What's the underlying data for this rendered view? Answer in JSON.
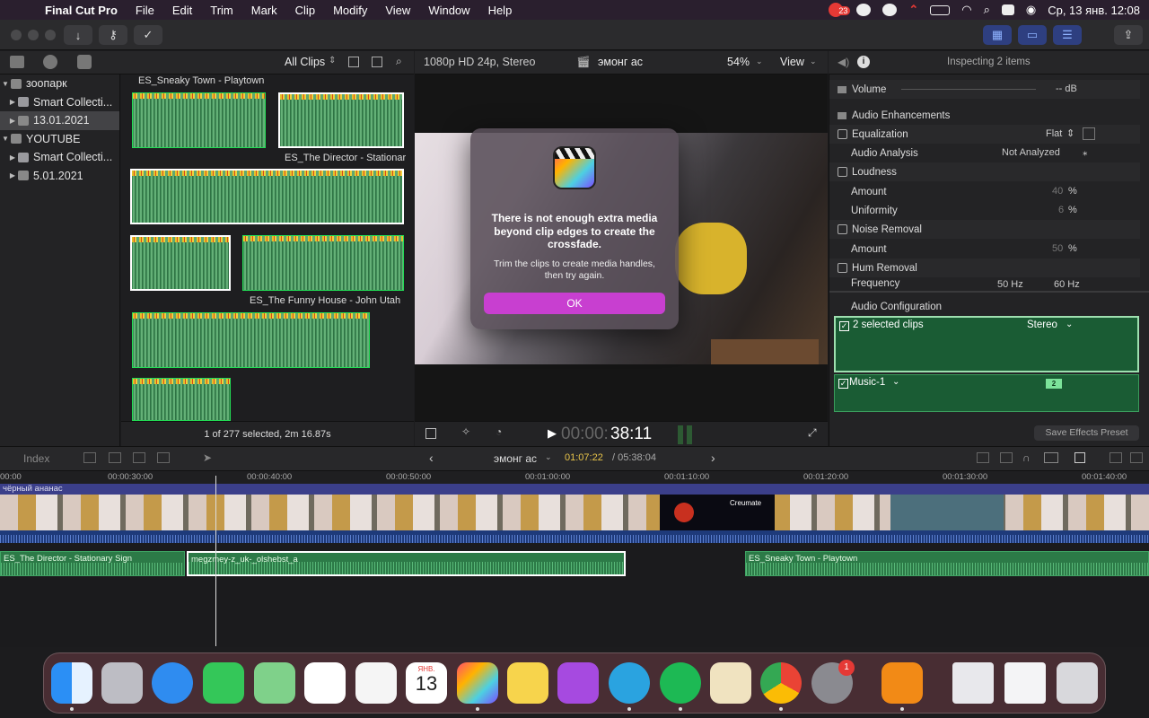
{
  "menubar": {
    "app": "Final Cut Pro",
    "items": [
      "File",
      "Edit",
      "Trim",
      "Mark",
      "Clip",
      "Modify",
      "View",
      "Window",
      "Help"
    ],
    "notification_count": "23",
    "datetime": "Ср, 13 янв.  12:08"
  },
  "browser": {
    "filter": "All Clips",
    "library": [
      {
        "label": "зоопарк",
        "level": 0,
        "expanded": true
      },
      {
        "label": "Smart Collecti...",
        "level": 1
      },
      {
        "label": "13.01.2021",
        "level": 1,
        "selected": true
      },
      {
        "label": "YOUTUBE",
        "level": 0,
        "expanded": true
      },
      {
        "label": "Smart Collecti...",
        "level": 1
      },
      {
        "label": "5.01.2021",
        "level": 1
      }
    ],
    "clip_labels": {
      "c1": "ES_Sneaky Town - Playtown",
      "c2": "ES_The Director - Stationar",
      "c3": "ES_The Funny House - John Utah"
    },
    "status": "1 of 277 selected, 2m 16.87s"
  },
  "viewer": {
    "format": "1080p HD 24p, Stereo",
    "project": "эмонг ас",
    "zoom": "54%",
    "view_menu": "View",
    "timecode_dim": "00:00:",
    "timecode": "38:11"
  },
  "dialog": {
    "title": "There is not enough extra media beyond clip edges to create the crossfade.",
    "message": "Trim the clips to create media handles, then try again.",
    "ok": "OK"
  },
  "inspector": {
    "title": "Inspecting 2 items",
    "volume_label": "Volume",
    "volume_value": "-- dB",
    "audio_enh": "Audio Enhancements",
    "eq_label": "Equalization",
    "eq_value": "Flat",
    "analysis_label": "Audio Analysis",
    "analysis_value": "Not Analyzed",
    "loudness": "Loudness",
    "amount": "Amount",
    "amount_val1": "40",
    "uniformity": "Uniformity",
    "uniformity_val": "6",
    "percent": "%",
    "noise": "Noise Removal",
    "amount_val2": "50",
    "hum": "Hum Removal",
    "frequency": "Frequency",
    "hz50": "50 Hz",
    "hz60": "60 Hz",
    "audio_config": "Audio Configuration",
    "selected_clips": "2 selected clips",
    "stereo": "Stereo",
    "music": "Music-1",
    "music_badge": "2",
    "save_preset": "Save Effects Preset"
  },
  "timeline": {
    "index": "Index",
    "project": "эмонг ас",
    "timecode_current": "01:07:22",
    "timecode_total": "/ 05:38:04",
    "ruler": [
      "00:00",
      "00:00:30:00",
      "00:00:40:00",
      "00:00:50:00",
      "00:01:00:00",
      "00:01:10:00",
      "00:01:20:00",
      "00:01:30:00",
      "00:01:40:00"
    ],
    "title_track": "чёрный ананас",
    "audio_clips": [
      "ES_The Director - Stationary Sign",
      "megzmey-z_uk-_olshebst_a",
      "ES_Sneaky Town - Playtown"
    ],
    "thumb_text": "Creumate"
  },
  "dock": {
    "calendar_month": "ЯНВ.",
    "calendar_day": "13",
    "settings_badge": "1"
  },
  "colors": {
    "accent": "#c83fd0",
    "audio_green": "#2c7a47",
    "selection": "#ffffff"
  }
}
